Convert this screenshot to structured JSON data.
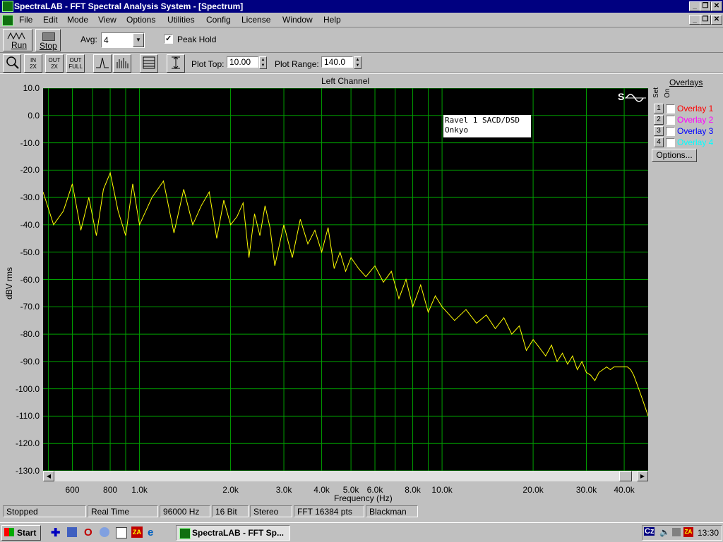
{
  "window": {
    "title": "SpectraLAB - FFT Spectral Analysis System - [Spectrum]"
  },
  "menu": [
    "File",
    "Edit",
    "Mode",
    "View",
    "Options",
    "Utilities",
    "Config",
    "License",
    "Window",
    "Help"
  ],
  "toolbar": {
    "run_label": "Run",
    "stop_label": "Stop",
    "avg_label": "Avg:",
    "avg_value": "4",
    "peak_hold_label": "Peak Hold",
    "peak_hold_checked": true,
    "plot_top_label": "Plot Top:",
    "plot_top_value": "10.00",
    "plot_range_label": "Plot Range:",
    "plot_range_value": "140.0",
    "zoom_buttons": [
      {
        "top": "IN",
        "bottom": "2X"
      },
      {
        "top": "OUT",
        "bottom": "2X"
      },
      {
        "top": "OUT",
        "bottom": "FULL"
      }
    ]
  },
  "plot": {
    "title": "Left Channel",
    "annotation_line1": "Ravel 1 SACD/DSD",
    "annotation_line2": "Onkyo",
    "logo_text": "S"
  },
  "overlays": {
    "header": "Overlays",
    "set_label": "Set",
    "on_label": "On",
    "items": [
      {
        "num": "1",
        "label": "Overlay 1",
        "color": "#ff0000"
      },
      {
        "num": "2",
        "label": "Overlay 2",
        "color": "#ff00ff"
      },
      {
        "num": "3",
        "label": "Overlay 3",
        "color": "#0000ff"
      },
      {
        "num": "4",
        "label": "Overlay 4",
        "color": "#00ffff"
      }
    ],
    "options_label": "Options..."
  },
  "status": [
    "Stopped",
    "Real Time",
    "96000 Hz",
    "16 Bit",
    "Stereo",
    "FFT 16384 pts",
    "Blackman"
  ],
  "taskbar": {
    "start_label": "Start",
    "task_label": "SpectraLAB - FFT Sp...",
    "clock": "13:30",
    "tray_text": "Cz"
  },
  "chart_data": {
    "type": "line",
    "title": "Left Channel",
    "xlabel": "Frequency (Hz)",
    "ylabel": "dBV rms",
    "x_scale": "log",
    "xlim": [
      480,
      48000
    ],
    "ylim": [
      -130,
      10
    ],
    "y_ticks": [
      "10.0",
      "0.0",
      "-10.0",
      "-20.0",
      "-30.0",
      "-40.0",
      "-50.0",
      "-60.0",
      "-70.0",
      "-80.0",
      "-90.0",
      "-100.0",
      "-110.0",
      "-120.0",
      "-130.0"
    ],
    "x_ticks": [
      {
        "v": 600,
        "label": "600"
      },
      {
        "v": 800,
        "label": "800"
      },
      {
        "v": 1000,
        "label": "1.0k"
      },
      {
        "v": 2000,
        "label": "2.0k"
      },
      {
        "v": 3000,
        "label": "3.0k"
      },
      {
        "v": 4000,
        "label": "4.0k"
      },
      {
        "v": 5000,
        "label": "5.0k"
      },
      {
        "v": 6000,
        "label": "6.0k"
      },
      {
        "v": 8000,
        "label": "8.0k"
      },
      {
        "v": 10000,
        "label": "10.0k"
      },
      {
        "v": 20000,
        "label": "20.0k"
      },
      {
        "v": 30000,
        "label": "30.0k"
      },
      {
        "v": 40000,
        "label": "40.0k"
      }
    ],
    "grid": true,
    "line_color": "#ffff00",
    "grid_color": "#00a000",
    "series": [
      {
        "x": [
          480,
          520,
          560,
          600,
          640,
          680,
          720,
          760,
          800,
          850,
          900,
          950,
          1000,
          1100,
          1200,
          1300,
          1400,
          1500,
          1600,
          1700,
          1800,
          1900,
          2000,
          2100,
          2200,
          2300,
          2400,
          2500,
          2600,
          2700,
          2800,
          3000,
          3200,
          3400,
          3600,
          3800,
          4000,
          4200,
          4400,
          4600,
          4800,
          5000,
          5300,
          5600,
          6000,
          6400,
          6800,
          7200,
          7600,
          8000,
          8500,
          9000,
          9500,
          10000,
          11000,
          12000,
          13000,
          14000,
          15000,
          16000,
          17000,
          18000,
          19000,
          20000,
          21000,
          22000,
          23000,
          24000,
          25000,
          26000,
          27000,
          28000,
          29000,
          30000,
          31000,
          32000,
          33000,
          34000,
          35000,
          36000,
          37000,
          38000,
          39000,
          40000,
          41000,
          42000,
          43000,
          44000,
          45000,
          46000,
          47000,
          48000
        ],
        "y": [
          -28,
          -40,
          -35,
          -25,
          -42,
          -30,
          -44,
          -27,
          -21,
          -35,
          -44,
          -25,
          -40,
          -30,
          -24,
          -43,
          -27,
          -40,
          -33,
          -28,
          -45,
          -31,
          -40,
          -37,
          -32,
          -52,
          -36,
          -44,
          -33,
          -41,
          -55,
          -40,
          -52,
          -38,
          -47,
          -42,
          -50,
          -41,
          -56,
          -50,
          -57,
          -52,
          -56,
          -59,
          -55,
          -61,
          -57,
          -67,
          -60,
          -70,
          -62,
          -72,
          -66,
          -70,
          -75,
          -71,
          -76,
          -73,
          -78,
          -74,
          -80,
          -77,
          -86,
          -82,
          -85,
          -88,
          -84,
          -90,
          -87,
          -91,
          -88,
          -93,
          -90,
          -94,
          -95,
          -97,
          -94,
          -93,
          -92,
          -93,
          -92,
          -92,
          -92,
          -92,
          -92,
          -93,
          -95,
          -98,
          -101,
          -104,
          -107,
          -110
        ]
      }
    ]
  }
}
